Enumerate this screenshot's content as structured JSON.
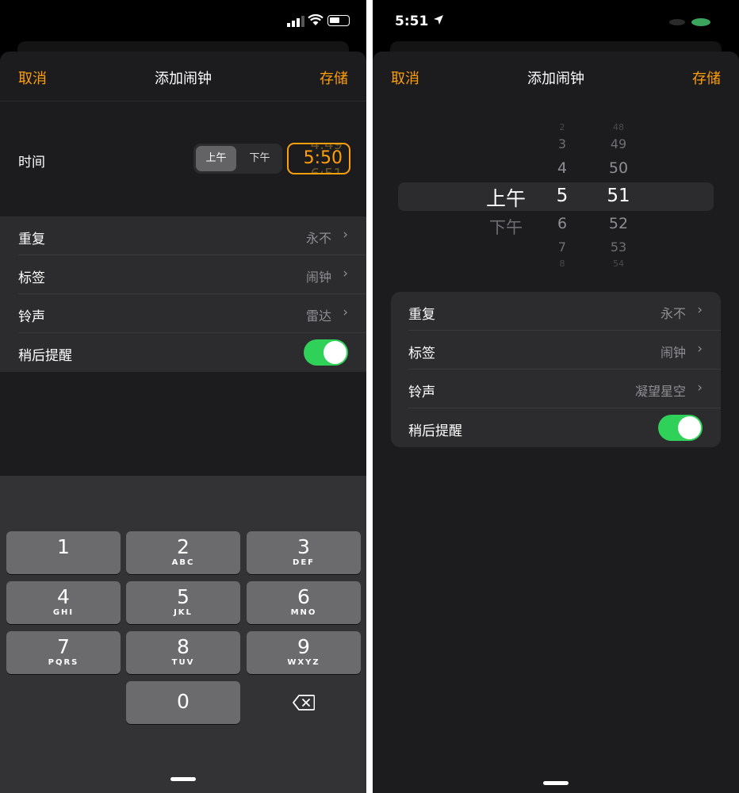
{
  "colors": {
    "accent": "#ff9f0a",
    "toggle_on": "#30d158",
    "secondary_text": "#8e8e93"
  },
  "left": {
    "nav": {
      "cancel": "取消",
      "title": "添加闹钟",
      "save": "存储"
    },
    "time": {
      "label": "时间",
      "am": "上午",
      "pm": "下午",
      "value": "5:50",
      "ghost_above": "4:49",
      "ghost_below": "6:51"
    },
    "rows": [
      {
        "label": "重复",
        "value": "永不"
      },
      {
        "label": "标签",
        "value": "闹钟"
      },
      {
        "label": "铃声",
        "value": "雷达"
      },
      {
        "label": "稍后提醒",
        "toggle_on": true
      }
    ],
    "keypad": {
      "keys": [
        {
          "num": "1",
          "letters": ""
        },
        {
          "num": "2",
          "letters": "ABC"
        },
        {
          "num": "3",
          "letters": "DEF"
        },
        {
          "num": "4",
          "letters": "GHI"
        },
        {
          "num": "5",
          "letters": "JKL"
        },
        {
          "num": "6",
          "letters": "MNO"
        },
        {
          "num": "7",
          "letters": "PQRS"
        },
        {
          "num": "8",
          "letters": "TUV"
        },
        {
          "num": "9",
          "letters": "WXYZ"
        },
        {
          "num": "0",
          "letters": ""
        }
      ],
      "delete_icon": "delete-backspace-icon"
    }
  },
  "right": {
    "status_time": "5:51",
    "nav": {
      "cancel": "取消",
      "title": "添加闹钟",
      "save": "存储"
    },
    "picker": {
      "ampm": [
        "上午",
        "下午"
      ],
      "hours": [
        "2",
        "3",
        "4",
        "5",
        "6",
        "7",
        "8"
      ],
      "minutes": [
        "48",
        "49",
        "50",
        "51",
        "52",
        "53",
        "54"
      ],
      "selected": {
        "ampm": "上午",
        "hour": "5",
        "minute": "51"
      }
    },
    "rows": [
      {
        "label": "重复",
        "value": "永不"
      },
      {
        "label": "标签",
        "value": "闹钟"
      },
      {
        "label": "铃声",
        "value": "凝望星空"
      },
      {
        "label": "稍后提醒",
        "toggle_on": true
      }
    ]
  }
}
